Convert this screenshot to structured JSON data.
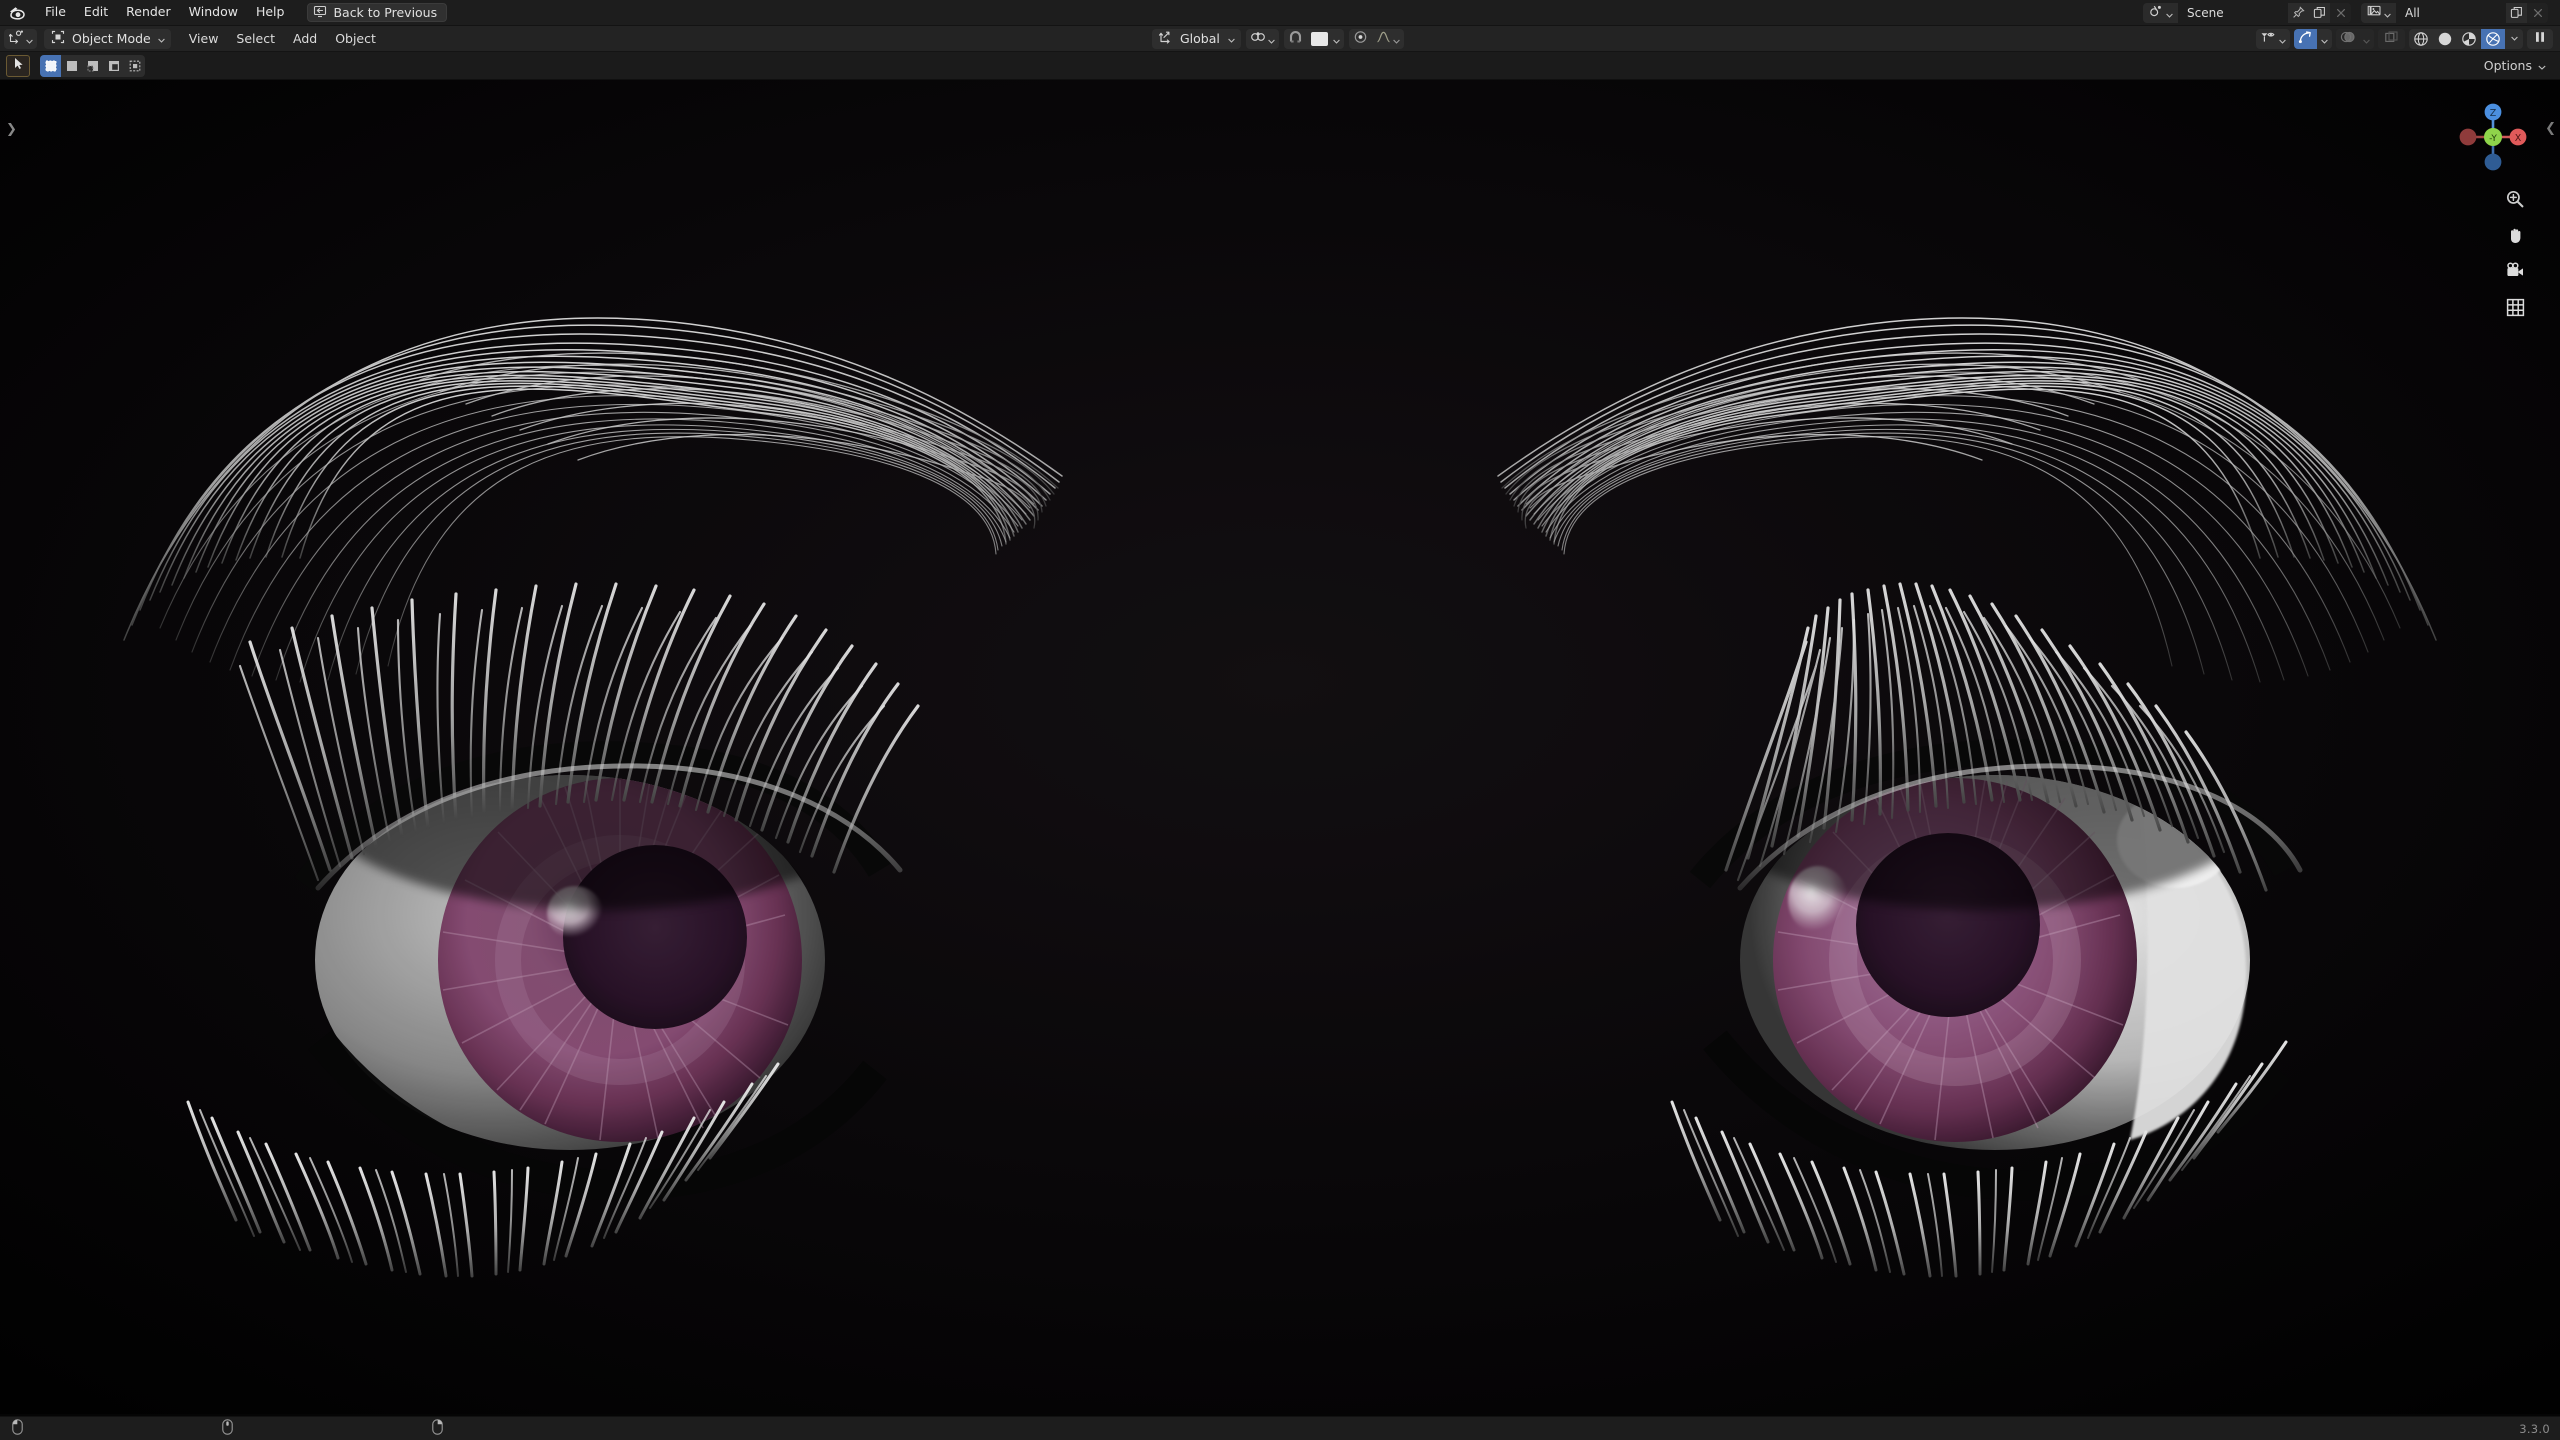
{
  "app": {
    "name": "Blender",
    "version": "3.3.0",
    "logo_icon": "blender-logo-icon"
  },
  "topbar": {
    "menus": [
      {
        "label": "File",
        "name": "menu-file"
      },
      {
        "label": "Edit",
        "name": "menu-edit"
      },
      {
        "label": "Render",
        "name": "menu-render"
      },
      {
        "label": "Window",
        "name": "menu-window"
      },
      {
        "label": "Help",
        "name": "menu-help"
      }
    ],
    "back_button": {
      "label": "Back to Previous",
      "icon": "back-to-previous-icon"
    },
    "scene": {
      "icon": "scene-data-icon",
      "name": "Scene",
      "pin_icon": "pin-icon",
      "new_icon": "new-scene-icon",
      "unlink_icon": "unlink-scene-icon"
    },
    "view_layer": {
      "icon": "view-layer-icon",
      "name": "All",
      "new_icon": "new-view-layer-icon",
      "remove_icon": "remove-view-layer-icon"
    }
  },
  "viewport_header": {
    "editor_type_icon": "editor-type-3d-viewport-icon",
    "mode": {
      "icon": "object-mode-icon",
      "label": "Object Mode",
      "chevron": "chevron-down-icon"
    },
    "menus": [
      {
        "label": "View",
        "name": "viewport-menu-view"
      },
      {
        "label": "Select",
        "name": "viewport-menu-select"
      },
      {
        "label": "Add",
        "name": "viewport-menu-add"
      },
      {
        "label": "Object",
        "name": "viewport-menu-object"
      }
    ],
    "transform_orientation": {
      "icon": "transform-orientation-icon",
      "label": "Global",
      "chevron": "chevron-down-icon"
    },
    "snapping": {
      "magnet_icon": "snap-magnet-icon",
      "magnet_enabled": false,
      "target_icon": "snap-target-icon"
    },
    "proportional_editing": {
      "toggle_icon": "proportional-editing-icon",
      "enabled": false,
      "falloff_icon": "smooth-falloff-icon"
    },
    "right_controls": {
      "visibility_icon": "object-visibility-icon",
      "gizmo_icon": "gizmo-toggle-icon",
      "gizmo_enabled": true,
      "overlays_icon": "overlays-toggle-icon",
      "overlays_enabled": false,
      "xray_icon": "toggle-xray-icon",
      "pause_icon": "pause-render-icon"
    },
    "shading_modes": [
      {
        "name": "shading-wireframe",
        "icon": "wireframe-icon",
        "active": false
      },
      {
        "name": "shading-solid",
        "icon": "solid-sphere-icon",
        "active": false
      },
      {
        "name": "shading-material-preview",
        "icon": "material-preview-icon",
        "active": false
      },
      {
        "name": "shading-rendered",
        "icon": "rendered-icon",
        "active": true
      }
    ]
  },
  "tool_header": {
    "active_tool_icon": "tweak-tool-icon",
    "select_modes": [
      {
        "name": "select-set",
        "icon": "select-set-icon",
        "active": true
      },
      {
        "name": "select-extend",
        "icon": "select-extend-icon",
        "active": false
      },
      {
        "name": "select-subtract",
        "icon": "select-subtract-icon",
        "active": false
      },
      {
        "name": "select-invert",
        "icon": "select-invert-icon",
        "active": false
      },
      {
        "name": "select-intersect",
        "icon": "select-intersect-icon",
        "active": false
      }
    ],
    "options": {
      "label": "Options",
      "chevron": "chevron-down-icon"
    }
  },
  "viewport": {
    "background_color": "#050505",
    "sidebar_toggle_icon": "expand-sidebar-chevron-icon",
    "nav_gizmo": {
      "axes": [
        {
          "label": "Z",
          "color": "#4b8fe0",
          "name": "gizmo-axis-z"
        },
        {
          "label": "X",
          "color": "#e05a5a",
          "name": "gizmo-axis-x"
        },
        {
          "label": "-Y",
          "color": "#8fd44b",
          "name": "gizmo-axis-negative-y"
        },
        {
          "label": "",
          "color": "#8f3b3b",
          "name": "gizmo-axis-negative-x"
        },
        {
          "label": "",
          "color": "#2f5c94",
          "name": "gizmo-axis-negative-z"
        }
      ]
    },
    "nav_tools": [
      {
        "name": "zoom-view-icon",
        "icon": "zoom-icon"
      },
      {
        "name": "pan-view-icon",
        "icon": "hand-icon"
      },
      {
        "name": "camera-view-icon",
        "icon": "camera-icon"
      },
      {
        "name": "toggle-orthographic-icon",
        "icon": "grid-icon"
      }
    ],
    "scene_content": {
      "description": "Photorealistic rendered pair of eyes with hair-particle eyelashes and eyebrows on black background",
      "iris_color": "#7a4568",
      "iris_highlight_color": "#d8b8cf",
      "pupil_color": "#2a1428",
      "sclera_color": "#e8e8e8",
      "hair_color": "#d9d9d9"
    }
  },
  "statusbar": {
    "hints": [
      {
        "icon": "mouse-left-button-icon",
        "label": "",
        "name": "status-hint-left-mouse"
      },
      {
        "icon": "mouse-middle-button-icon",
        "label": "",
        "name": "status-hint-middle-mouse"
      },
      {
        "icon": "mouse-right-button-icon",
        "label": "",
        "name": "status-hint-right-mouse"
      }
    ],
    "version": "3.3.0"
  }
}
